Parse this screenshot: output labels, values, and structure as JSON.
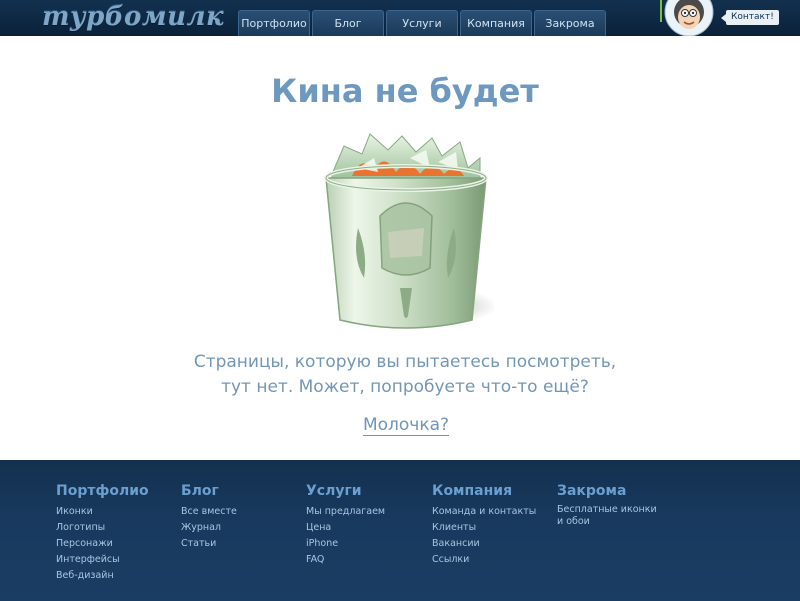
{
  "header": {
    "logo_text": "турбомилк",
    "nav": [
      {
        "label": "Портфолио"
      },
      {
        "label": "Блог"
      },
      {
        "label": "Услуги"
      },
      {
        "label": "Компания"
      },
      {
        "label": "Закрома"
      }
    ],
    "contact_label": "Контакт!"
  },
  "main": {
    "title": "Кина не будет",
    "message_line1": "Страницы, которую вы пытаетесь посмотреть,",
    "message_line2": "тут нет. Может, попробуете что-то ещё?",
    "link_label": "Молочка?"
  },
  "footer": {
    "columns": [
      {
        "heading": "Портфолио",
        "links": [
          "Иконки",
          "Логотипы",
          "Персонажи",
          "Интерфейсы",
          "Веб-дизайн"
        ]
      },
      {
        "heading": "Блог",
        "links": [
          "Все вместе",
          "Журнал",
          "Статьи"
        ]
      },
      {
        "heading": "Услуги",
        "links": [
          "Мы предлагаем",
          "Цена",
          "iPhone",
          "FAQ"
        ]
      },
      {
        "heading": "Компания",
        "links": [
          "Команда и контакты",
          "Клиенты",
          "Вакансии",
          "Ссылки"
        ]
      },
      {
        "heading": "Закрома",
        "links": [
          "Бесплатные иконки и обои"
        ]
      }
    ]
  },
  "colors": {
    "header_bg": "#0d2640",
    "footer_bg": "#193a5f",
    "title": "#6d98c0",
    "text": "#7396b7"
  },
  "icons": {
    "trash": "trash-can-icon",
    "avatar": "avatar-icon"
  }
}
